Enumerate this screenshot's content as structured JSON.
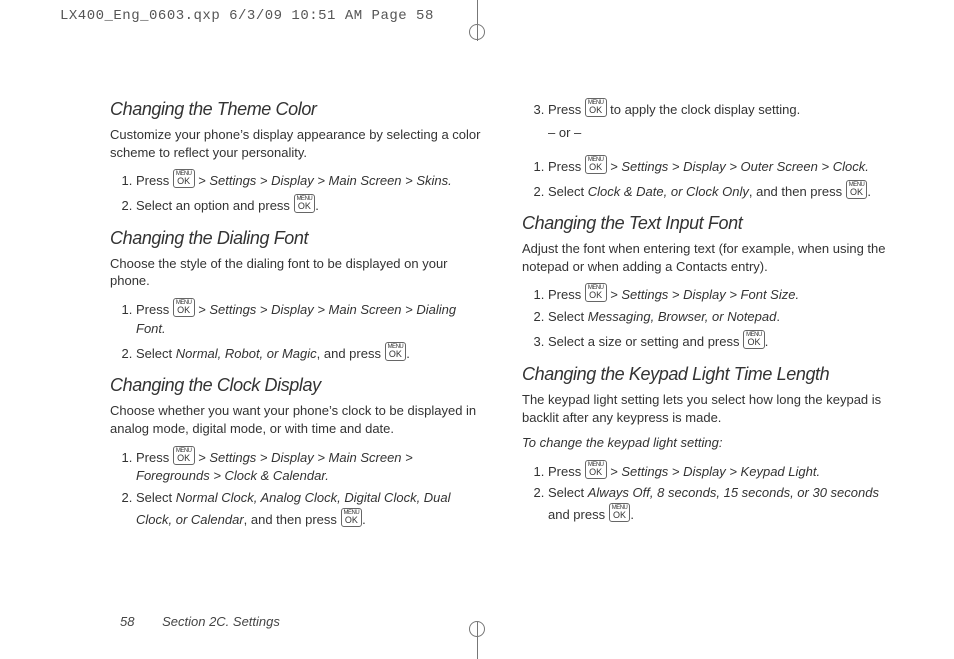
{
  "trim": "LX400_Eng_0603.qxp  6/3/09  10:51 AM  Page 58",
  "menuok": "OK",
  "menuok_top": "MENU",
  "left": {
    "h1": "Changing the Theme Color",
    "p1": "Customize your phone’s display appearance by selecting a color scheme to reflect your personality.",
    "l1a_pre": "Press ",
    "l1a_post": " > Settings > Display > Main Screen > Skins.",
    "l1b_pre": "Select an option and press ",
    "l1b_post": ".",
    "h2": "Changing the Dialing Font",
    "p2": "Choose the style of the dialing font to be displayed on your phone.",
    "l2a_pre": "Press ",
    "l2a_post": " > Settings > Display > Main Screen > Dialing Font.",
    "l2b_pre": "Select ",
    "l2b_opts": "Normal, Robot, or Magic",
    "l2b_mid": ", and press ",
    "l2b_post": ".",
    "h3": "Changing the Clock Display",
    "p3": "Choose whether you want your phone’s clock to be displayed in analog mode, digital mode, or with time and date.",
    "l3a_pre": "Press ",
    "l3a_post": " > Settings > Display > Main Screen > Foregrounds > Clock & Calendar.",
    "l3b_pre": "Select ",
    "l3b_opts": "Normal Clock, Analog Clock, Digital Clock, Dual Clock, or Calendar",
    "l3b_mid": ", and then press ",
    "l3b_post": "."
  },
  "right": {
    "r0_pre": "Press ",
    "r0_post": " to apply the clock display setting.",
    "or": "– or –",
    "r1_pre": "Press ",
    "r1_post": " > Settings > Display > Outer Screen > Clock.",
    "r2_pre": "Select ",
    "r2_opts": "Clock & Date, or Clock Only",
    "r2_mid": ", and then press ",
    "r2_post": ".",
    "h1": "Changing the Text Input Font",
    "p1": "Adjust the font when entering text (for example, when using the notepad or when adding a Contacts entry).",
    "t1_pre": "Press ",
    "t1_post": " > Settings > Display > Font Size.",
    "t2_pre": "Select ",
    "t2_opts": "Messaging, Browser, or Notepad",
    "t2_post": ".",
    "t3_pre": "Select a size or setting and press ",
    "t3_post": ".",
    "h2": "Changing the Keypad Light Time Length",
    "p2": "The keypad light setting lets you select how long the keypad is backlit after any keypress is made.",
    "p2sub": "To change the keypad light setting:",
    "k1_pre": "Press ",
    "k1_post": " > Settings > Display > Keypad Light.",
    "k2_pre": "Select ",
    "k2_opts": "Always Off, 8 seconds, 15 seconds, or 30 seconds",
    "k2_mid": " and press ",
    "k2_post": "."
  },
  "footer": {
    "page": "58",
    "section": "Section 2C. Settings"
  }
}
